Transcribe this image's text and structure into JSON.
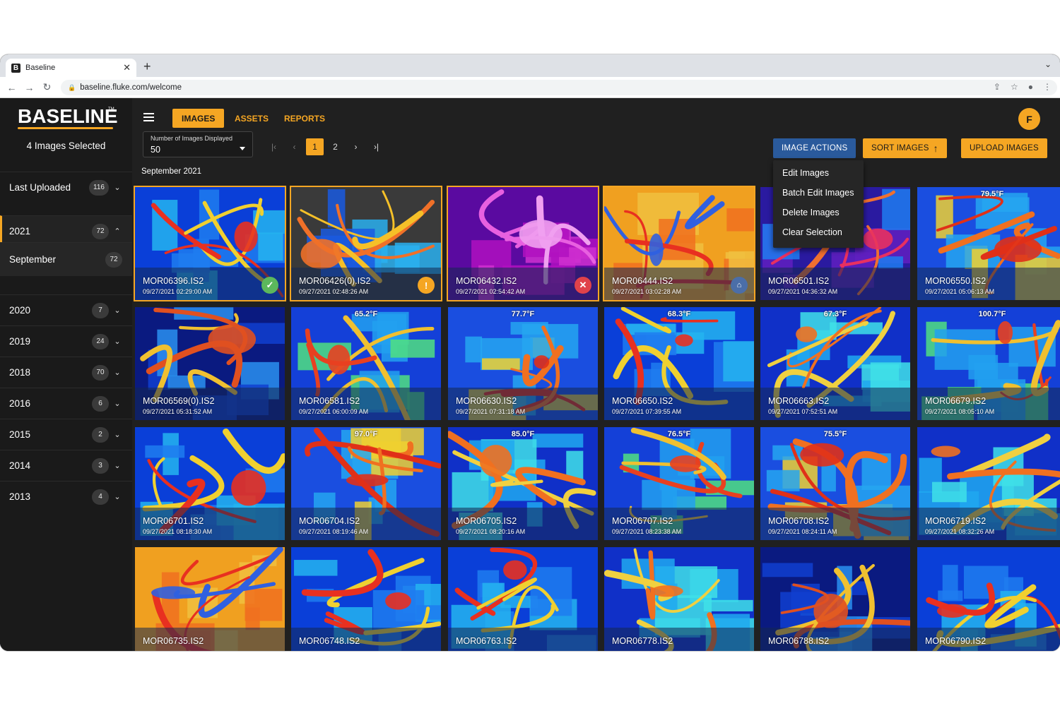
{
  "browser": {
    "tab_title": "Baseline",
    "tab_favicon": "B",
    "close_glyph": "✕",
    "new_tab_glyph": "+",
    "tab_menu_glyph": "⌄",
    "url": "baseline.fluke.com/welcome",
    "back_glyph": "←",
    "forward_glyph": "→",
    "reload_glyph": "↻",
    "lock_glyph": "🔒",
    "share_glyph": "⇪",
    "star_glyph": "☆",
    "profile_glyph": "●",
    "more_glyph": "⋮"
  },
  "sidebar": {
    "logo": "BASELINE",
    "logo_tm": "TM",
    "selected_text": "4 Images Selected",
    "last_uploaded": {
      "label": "Last Uploaded",
      "count": "116",
      "chevron": "⌄"
    },
    "years": [
      {
        "label": "2021",
        "count": "72",
        "chevron": "⌃"
      },
      {
        "label": "2020",
        "count": "7",
        "chevron": "⌄"
      },
      {
        "label": "2019",
        "count": "24",
        "chevron": "⌄"
      },
      {
        "label": "2018",
        "count": "70",
        "chevron": "⌄"
      },
      {
        "label": "2016",
        "count": "6",
        "chevron": "⌄"
      },
      {
        "label": "2015",
        "count": "2",
        "chevron": "⌄"
      },
      {
        "label": "2014",
        "count": "3",
        "chevron": "⌄"
      },
      {
        "label": "2013",
        "count": "4",
        "chevron": "⌄"
      }
    ],
    "month": {
      "label": "September",
      "count": "72"
    }
  },
  "header": {
    "tabs": [
      "IMAGES",
      "ASSETS",
      "REPORTS"
    ],
    "avatar": "F",
    "count_caption": "Number of Images Displayed",
    "count_value": "50",
    "pager": {
      "first": "|‹",
      "prev": "‹",
      "pages": [
        "1",
        "2"
      ],
      "next": "›",
      "last": "›|"
    },
    "image_actions": "IMAGE ACTIONS",
    "sort_images": "SORT IMAGES",
    "sort_glyph": "↑",
    "upload_images": "UPLOAD IMAGES",
    "month_label": "September 2021"
  },
  "menu": {
    "items": [
      "Edit Images",
      "Batch Edit Images",
      "Delete Images",
      "Clear Selection"
    ]
  },
  "status_glyphs": {
    "ok": "✓",
    "warn": "!",
    "err": "✕",
    "sent": "⌂"
  },
  "colors": {
    "accent": "#f5a623",
    "action_blue": "#2a5a9c",
    "ok": "#5cb85c",
    "error": "#e0424a"
  },
  "images": [
    {
      "name": "MOR06396.IS2",
      "date": "09/27/2021 02:29:00 AM",
      "temp": "",
      "selected": true,
      "status": "ok",
      "palette": "blue"
    },
    {
      "name": "MOR06426(0).IS2",
      "date": "09/27/2021 02:48:26 AM",
      "temp": "",
      "selected": true,
      "status": "warn",
      "palette": "dark"
    },
    {
      "name": "MOR06432.IS2",
      "date": "09/27/2021 02:54:42 AM",
      "temp": "",
      "selected": true,
      "status": "err",
      "palette": "purple"
    },
    {
      "name": "MOR06444.IS2",
      "date": "09/27/2021 03:02:28 AM",
      "temp": "",
      "selected": true,
      "status": "sent",
      "palette": "hot"
    },
    {
      "name": "MOR06501.IS2",
      "date": "09/27/2021 04:36:32 AM",
      "temp": "",
      "selected": false,
      "status": "",
      "palette": "violet"
    },
    {
      "name": "MOR06550.IS2",
      "date": "09/27/2021 05:06:13 AM",
      "temp": "79.5°F",
      "selected": false,
      "status": "",
      "palette": "warm"
    },
    {
      "name": "MOR06569(0).IS2",
      "date": "09/27/2021 05:31:52 AM",
      "temp": "",
      "selected": false,
      "status": "",
      "palette": "deep"
    },
    {
      "name": "MOR06581.IS2",
      "date": "09/27/2021 06:00:09 AM",
      "temp": "65.2°F",
      "selected": false,
      "status": "",
      "palette": "mixed"
    },
    {
      "name": "MOR06630.IS2",
      "date": "09/27/2021 07:31:18 AM",
      "temp": "77.7°F",
      "selected": false,
      "status": "",
      "palette": "warm"
    },
    {
      "name": "MOR06650.IS2",
      "date": "09/27/2021 07:39:55 AM",
      "temp": "68.3°F",
      "selected": false,
      "status": "",
      "palette": "blue"
    },
    {
      "name": "MOR06663.IS2",
      "date": "09/27/2021 07:52:51 AM",
      "temp": "67.3°F",
      "selected": false,
      "status": "",
      "palette": "cyan"
    },
    {
      "name": "MOR06679.IS2",
      "date": "09/27/2021 08:05:10 AM",
      "temp": "100.7°F",
      "selected": false,
      "status": "",
      "palette": "mixed"
    },
    {
      "name": "MOR06701.IS2",
      "date": "09/27/2021 08:18:30 AM",
      "temp": "",
      "selected": false,
      "status": "",
      "palette": "blue"
    },
    {
      "name": "MOR06704.IS2",
      "date": "09/27/2021 08:19:46 AM",
      "temp": "97.0°F",
      "selected": false,
      "status": "",
      "palette": "warm"
    },
    {
      "name": "MOR06705.IS2",
      "date": "09/27/2021 08:20:16 AM",
      "temp": "85.0°F",
      "selected": false,
      "status": "",
      "palette": "cyan"
    },
    {
      "name": "MOR06707.IS2",
      "date": "09/27/2021 08:23:38 AM",
      "temp": "76.5°F",
      "selected": false,
      "status": "",
      "palette": "mixed"
    },
    {
      "name": "MOR06708.IS2",
      "date": "09/27/2021 08:24:11 AM",
      "temp": "75.5°F",
      "selected": false,
      "status": "",
      "palette": "warm"
    },
    {
      "name": "MOR06719.IS2",
      "date": "09/27/2021 08:32:26 AM",
      "temp": "",
      "selected": false,
      "status": "",
      "palette": "cyan"
    },
    {
      "name": "MOR06735.IS2",
      "date": "",
      "temp": "",
      "selected": false,
      "status": "",
      "palette": "hot"
    },
    {
      "name": "MOR06748.IS2",
      "date": "",
      "temp": "",
      "selected": false,
      "status": "",
      "palette": "blue"
    },
    {
      "name": "MOR06763.IS2",
      "date": "",
      "temp": "",
      "selected": false,
      "status": "",
      "palette": "blue"
    },
    {
      "name": "MOR06778.IS2",
      "date": "",
      "temp": "",
      "selected": false,
      "status": "",
      "palette": "cyan"
    },
    {
      "name": "MOR06788.IS2",
      "date": "",
      "temp": "",
      "selected": false,
      "status": "",
      "palette": "deep"
    },
    {
      "name": "MOR06790.IS2",
      "date": "",
      "temp": "",
      "selected": false,
      "status": "",
      "palette": "blue"
    }
  ]
}
